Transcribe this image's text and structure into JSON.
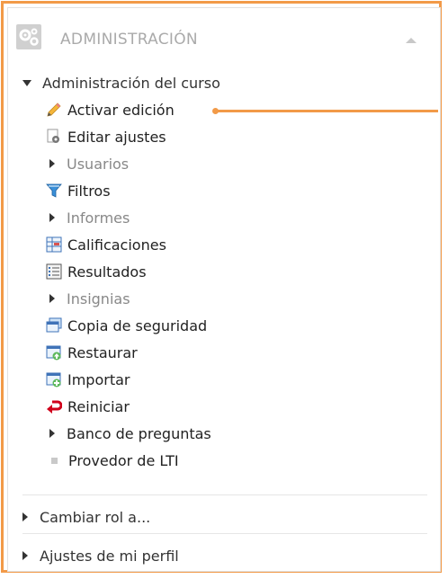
{
  "block": {
    "title": "ADMINISTRACIÓN",
    "header_icon": "gears-icon",
    "collapse_icon": "chevron-up-icon"
  },
  "course_admin": {
    "label": "Administración del curso",
    "items": [
      {
        "label": "Activar edición",
        "icon": "pencil-icon"
      },
      {
        "label": "Editar ajustes",
        "icon": "settings-document-icon"
      },
      {
        "label": "Usuarios",
        "icon": "expand-triangle-icon"
      },
      {
        "label": "Filtros",
        "icon": "filter-icon"
      },
      {
        "label": "Informes",
        "icon": "expand-triangle-icon"
      },
      {
        "label": "Calificaciones",
        "icon": "grades-icon"
      },
      {
        "label": "Resultados",
        "icon": "outcomes-icon"
      },
      {
        "label": "Insignias",
        "icon": "expand-triangle-icon"
      },
      {
        "label": "Copia de seguridad",
        "icon": "backup-icon"
      },
      {
        "label": "Restaurar",
        "icon": "restore-icon"
      },
      {
        "label": "Importar",
        "icon": "import-icon"
      },
      {
        "label": "Reiniciar",
        "icon": "reset-icon"
      },
      {
        "label": "Banco de preguntas",
        "icon": "expand-triangle-icon"
      },
      {
        "label": "Provedor de LTI",
        "icon": "bullet-icon"
      }
    ]
  },
  "other_sections": [
    {
      "label": "Cambiar rol a..."
    },
    {
      "label": "Ajustes de mi perfil"
    }
  ],
  "colors": {
    "highlight_border": "#f29a48",
    "muted_text": "#888888",
    "text": "#333333"
  }
}
